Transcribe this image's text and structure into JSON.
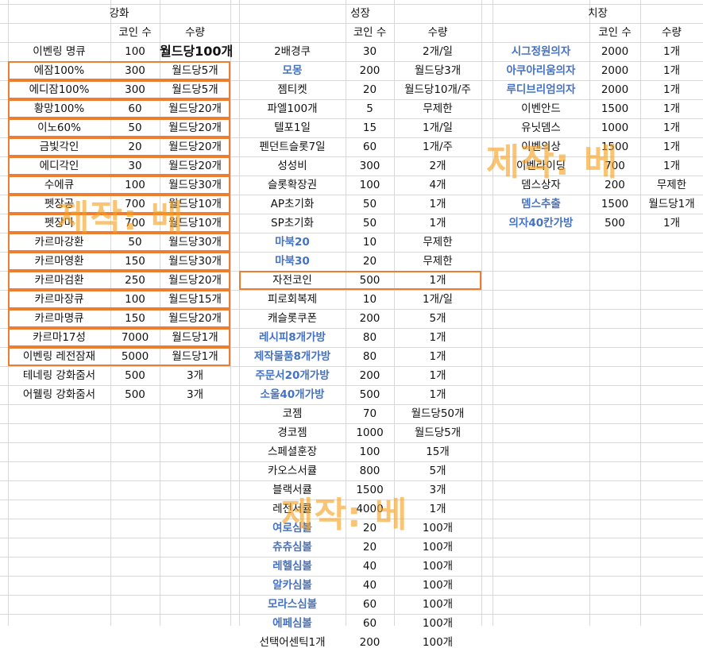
{
  "sections": [
    {
      "title": "강화",
      "header": [
        "",
        "코인 수",
        "수량"
      ],
      "rows": [
        {
          "name": "이벤링 명큐",
          "coin": "100",
          "qty": "월드당100개",
          "qty_big": true
        },
        {
          "name": "에잠100%",
          "coin": "300",
          "qty": "월드당5개",
          "hl": true
        },
        {
          "name": "에디잠100%",
          "coin": "300",
          "qty": "월드당5개",
          "hl": true
        },
        {
          "name": "황망100%",
          "coin": "60",
          "qty": "월드당20개",
          "hl": true
        },
        {
          "name": "이노60%",
          "coin": "50",
          "qty": "월드당20개",
          "hl": true
        },
        {
          "name": "금빛각인",
          "coin": "20",
          "qty": "월드당20개",
          "hl": true
        },
        {
          "name": "에디각인",
          "coin": "30",
          "qty": "월드당20개",
          "hl": true
        },
        {
          "name": "수에큐",
          "coin": "100",
          "qty": "월드당30개",
          "hl": true
        },
        {
          "name": "펫장공",
          "coin": "700",
          "qty": "월드당10개",
          "hl": true
        },
        {
          "name": "펫장마",
          "coin": "700",
          "qty": "월드당10개",
          "hl": true
        },
        {
          "name": "카르마강환",
          "coin": "50",
          "qty": "월드당30개",
          "hl": true
        },
        {
          "name": "카르마영환",
          "coin": "150",
          "qty": "월드당30개",
          "hl": true
        },
        {
          "name": "카르마검환",
          "coin": "250",
          "qty": "월드당20개",
          "hl": true
        },
        {
          "name": "카르마장큐",
          "coin": "100",
          "qty": "월드당15개",
          "hl": true
        },
        {
          "name": "카르마명큐",
          "coin": "150",
          "qty": "월드당20개",
          "hl": true
        },
        {
          "name": "카르마17성",
          "coin": "7000",
          "qty": "월드당1개",
          "hl": true
        },
        {
          "name": "이벤링 레전잠재",
          "coin": "5000",
          "qty": "월드당1개",
          "hl": true
        },
        {
          "name": "테네링 강화줌서",
          "coin": "500",
          "qty": "3개"
        },
        {
          "name": "어웰링 강화줌서",
          "coin": "500",
          "qty": "3개"
        }
      ]
    },
    {
      "title": "성장",
      "header": [
        "",
        "코인 수",
        "수량"
      ],
      "rows": [
        {
          "name": "2배경쿠",
          "coin": "30",
          "qty": "2개/일"
        },
        {
          "name": "모몽",
          "coin": "200",
          "qty": "월드당3개",
          "blue": true
        },
        {
          "name": "젬티켓",
          "coin": "20",
          "qty": "월드당10개/주"
        },
        {
          "name": "파엘100개",
          "coin": "5",
          "qty": "무제한"
        },
        {
          "name": "텔포1일",
          "coin": "15",
          "qty": "1개/일"
        },
        {
          "name": "펜던트슬롯7일",
          "coin": "60",
          "qty": "1개/주"
        },
        {
          "name": "성성비",
          "coin": "300",
          "qty": "2개"
        },
        {
          "name": "슬롯확장권",
          "coin": "100",
          "qty": "4개"
        },
        {
          "name": "AP초기화",
          "coin": "50",
          "qty": "1개"
        },
        {
          "name": "SP초기화",
          "coin": "50",
          "qty": "1개"
        },
        {
          "name": "마북20",
          "coin": "10",
          "qty": "무제한",
          "blue": true
        },
        {
          "name": "마북30",
          "coin": "20",
          "qty": "무제한",
          "blue": true
        },
        {
          "name": "자전코인",
          "coin": "500",
          "qty": "1개",
          "hl": true
        },
        {
          "name": "피로회복제",
          "coin": "10",
          "qty": "1개/일"
        },
        {
          "name": "캐슬롯쿠폰",
          "coin": "200",
          "qty": "5개"
        },
        {
          "name": "레시피8개가방",
          "coin": "80",
          "qty": "1개",
          "blue": true
        },
        {
          "name": "제작물품8개가방",
          "coin": "80",
          "qty": "1개",
          "blue": true
        },
        {
          "name": "주문서20개가방",
          "coin": "200",
          "qty": "1개",
          "blue": true
        },
        {
          "name": "소울40개가방",
          "coin": "500",
          "qty": "1개",
          "blue": true
        },
        {
          "name": "코젬",
          "coin": "70",
          "qty": "월드당50개"
        },
        {
          "name": "경코젬",
          "coin": "1000",
          "qty": "월드당5개"
        },
        {
          "name": "스페셜훈장",
          "coin": "100",
          "qty": "15개"
        },
        {
          "name": "카오스서큘",
          "coin": "800",
          "qty": "5개"
        },
        {
          "name": "블랙서큘",
          "coin": "1500",
          "qty": "3개"
        },
        {
          "name": "레전서큘",
          "coin": "4000",
          "qty": "1개"
        },
        {
          "name": "여로심볼",
          "coin": "20",
          "qty": "100개",
          "blue": true
        },
        {
          "name": "츄츄심볼",
          "coin": "20",
          "qty": "100개",
          "blue": true
        },
        {
          "name": "레헬심볼",
          "coin": "40",
          "qty": "100개",
          "blue": true
        },
        {
          "name": "알카심볼",
          "coin": "40",
          "qty": "100개",
          "blue": true
        },
        {
          "name": "모라스심볼",
          "coin": "60",
          "qty": "100개",
          "blue": true
        },
        {
          "name": "에페심볼",
          "coin": "60",
          "qty": "100개",
          "blue": true
        },
        {
          "name": "선택어센틱1개",
          "coin": "200",
          "qty": "100개"
        }
      ]
    },
    {
      "title": "치장",
      "header": [
        "",
        "코인 수",
        "수량"
      ],
      "rows": [
        {
          "name": "시그정원의자",
          "coin": "2000",
          "qty": "1개",
          "blue": true
        },
        {
          "name": "아쿠아리움의자",
          "coin": "2000",
          "qty": "1개",
          "blue": true
        },
        {
          "name": "루디브리엄의자",
          "coin": "2000",
          "qty": "1개",
          "blue": true
        },
        {
          "name": "이벤안드",
          "coin": "1500",
          "qty": "1개"
        },
        {
          "name": "유닛뎀스",
          "coin": "1000",
          "qty": "1개"
        },
        {
          "name": "이벤의상",
          "coin": "1500",
          "qty": "1개"
        },
        {
          "name": "이벤라이딩",
          "coin": "700",
          "qty": "1개"
        },
        {
          "name": "뎀스상자",
          "coin": "200",
          "qty": "무제한"
        },
        {
          "name": "뎀스추출",
          "coin": "1500",
          "qty": "월드당1개",
          "blue": true
        },
        {
          "name": "의자40칸가방",
          "coin": "500",
          "qty": "1개",
          "blue": true
        }
      ]
    }
  ],
  "watermarks": [
    "제작: 베",
    "제작: 베",
    "제작: 베"
  ],
  "colors": {
    "grid": "#d9d9d9",
    "highlight": "#ed7d31",
    "blue_text": "#4472c4",
    "watermark": "#f5a01e"
  }
}
